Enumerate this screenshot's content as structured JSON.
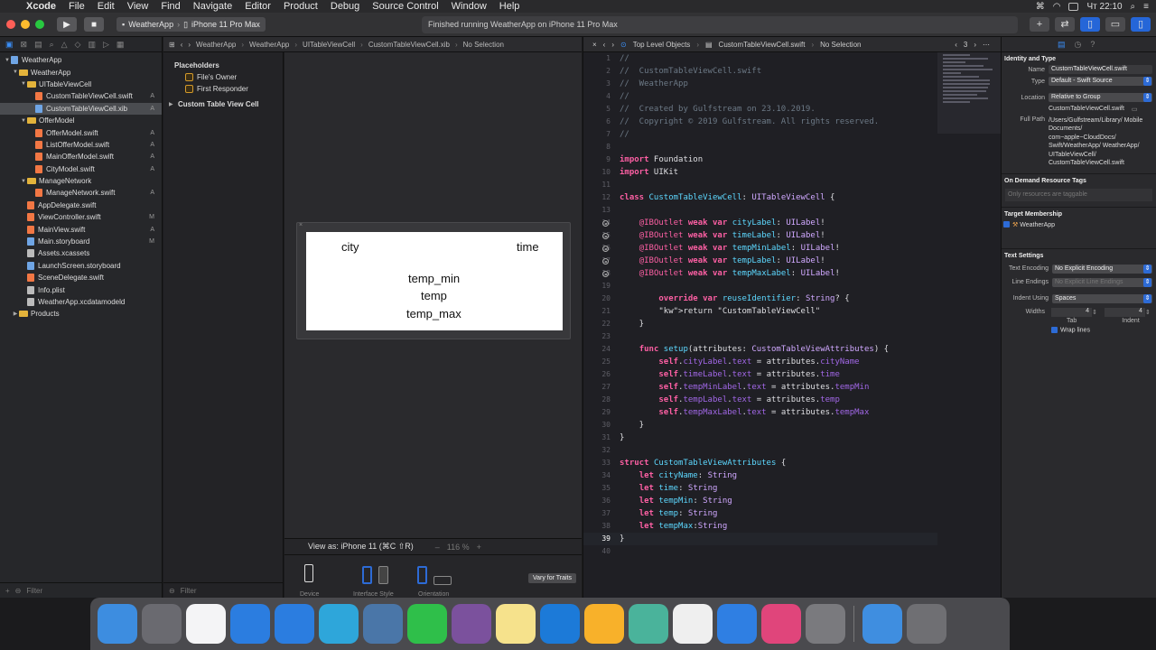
{
  "menubar": {
    "app": "Xcode",
    "items": [
      "File",
      "Edit",
      "View",
      "Find",
      "Navigate",
      "Editor",
      "Product",
      "Debug",
      "Source Control",
      "Window",
      "Help"
    ],
    "clock": "Чт 22:10"
  },
  "toolbar": {
    "scheme": "WeatherApp",
    "device": "iPhone 11 Pro Max",
    "activity": "Finished running WeatherApp on iPhone 11 Pro Max"
  },
  "navigator": {
    "filter_placeholder": "Filter",
    "rows": [
      {
        "label": "WeatherApp",
        "level": 0,
        "kind": "project",
        "badge": ""
      },
      {
        "label": "WeatherApp",
        "level": 1,
        "kind": "folder",
        "badge": ""
      },
      {
        "label": "UITableViewCell",
        "level": 2,
        "kind": "folder",
        "badge": ""
      },
      {
        "label": "CustomTableViewCell.swift",
        "level": 3,
        "kind": "swift",
        "badge": "A"
      },
      {
        "label": "CustomTableViewCell.xib",
        "level": 3,
        "kind": "xib",
        "badge": "A"
      },
      {
        "label": "OfferModel",
        "level": 2,
        "kind": "folder",
        "badge": ""
      },
      {
        "label": "OfferModel.swift",
        "level": 3,
        "kind": "swift",
        "badge": "A"
      },
      {
        "label": "ListOfferModel.swift",
        "level": 3,
        "kind": "swift",
        "badge": "A"
      },
      {
        "label": "MainOfferModel.swift",
        "level": 3,
        "kind": "swift",
        "badge": "A"
      },
      {
        "label": "CityModel.swift",
        "level": 3,
        "kind": "swift",
        "badge": "A"
      },
      {
        "label": "ManageNetwork",
        "level": 2,
        "kind": "folder",
        "badge": ""
      },
      {
        "label": "ManageNetwork.swift",
        "level": 3,
        "kind": "swift",
        "badge": "A"
      },
      {
        "label": "AppDelegate.swift",
        "level": 2,
        "kind": "swift",
        "badge": ""
      },
      {
        "label": "ViewController.swift",
        "level": 2,
        "kind": "swift",
        "badge": "M"
      },
      {
        "label": "MainView.swift",
        "level": 2,
        "kind": "swift",
        "badge": "A"
      },
      {
        "label": "Main.storyboard",
        "level": 2,
        "kind": "xib",
        "badge": "M"
      },
      {
        "label": "Assets.xcassets",
        "level": 2,
        "kind": "plain",
        "badge": ""
      },
      {
        "label": "LaunchScreen.storyboard",
        "level": 2,
        "kind": "xib",
        "badge": ""
      },
      {
        "label": "SceneDelegate.swift",
        "level": 2,
        "kind": "swift",
        "badge": ""
      },
      {
        "label": "Info.plist",
        "level": 2,
        "kind": "plain",
        "badge": ""
      },
      {
        "label": "WeatherApp.xcdatamodeld",
        "level": 2,
        "kind": "plain",
        "badge": ""
      },
      {
        "label": "Products",
        "level": 1,
        "kind": "folder",
        "badge": ""
      }
    ]
  },
  "ib_jumpbar": {
    "crumbs": [
      "WeatherApp",
      "WeatherApp",
      "UITableViewCell",
      "CustomTableViewCell.xib",
      "No Selection"
    ]
  },
  "outline": {
    "placeholders": "Placeholders",
    "files_owner": "File's Owner",
    "first_responder": "First Responder",
    "cell": "Custom Table View Cell",
    "filter_placeholder": "Filter"
  },
  "cell_labels": {
    "city": "city",
    "time": "time",
    "temp_min": "temp_min",
    "temp": "temp",
    "temp_max": "temp_max"
  },
  "ib_bottom": {
    "view_as": "View as: iPhone 11 (⌘C ⇧R)",
    "zoom": "116 %",
    "device": "Device",
    "interface_style": "Interface Style",
    "orientation": "Orientation",
    "vary": "Vary for Traits"
  },
  "editor_jumpbar": {
    "crumbs": [
      "Top Level Objects",
      "CustomTableViewCell.swift",
      "No Selection"
    ],
    "counter": "3"
  },
  "code_lines": [
    {
      "n": "1",
      "t": "//",
      "c": "c"
    },
    {
      "n": "2",
      "t": "//  CustomTableViewCell.swift",
      "c": "c"
    },
    {
      "n": "3",
      "t": "//  WeatherApp",
      "c": "c"
    },
    {
      "n": "4",
      "t": "//",
      "c": "c"
    },
    {
      "n": "5",
      "t": "//  Created by Gulfstream on 23.10.2019.",
      "c": "c"
    },
    {
      "n": "6",
      "t": "//  Copyright © 2019 Gulfstream. All rights reserved.",
      "c": "c"
    },
    {
      "n": "7",
      "t": "//",
      "c": "c"
    },
    {
      "n": "8",
      "t": "",
      "c": ""
    },
    {
      "n": "9",
      "t": "import Foundation",
      "c": "imp"
    },
    {
      "n": "10",
      "t": "import UIKit",
      "c": "imp"
    },
    {
      "n": "11",
      "t": "",
      "c": ""
    },
    {
      "n": "12",
      "t": "class CustomTableViewCell: UITableViewCell {",
      "c": "cls"
    },
    {
      "n": "13",
      "t": "",
      "c": ""
    },
    {
      "n": "14",
      "t": "    @IBOutlet weak var cityLabel: UILabel!",
      "c": "out",
      "v": "cityLabel"
    },
    {
      "n": "15",
      "t": "    @IBOutlet weak var timeLabel: UILabel!",
      "c": "out",
      "v": "timeLabel"
    },
    {
      "n": "16",
      "t": "    @IBOutlet weak var tempMinLabel: UILabel!",
      "c": "out",
      "v": "tempMinLabel"
    },
    {
      "n": "17",
      "t": "    @IBOutlet weak var tempLabel: UILabel!",
      "c": "out",
      "v": "tempLabel"
    },
    {
      "n": "18",
      "t": "    @IBOutlet weak var tempMaxLabel: UILabel!",
      "c": "out",
      "v": "tempMaxLabel"
    },
    {
      "n": "19",
      "t": "",
      "c": ""
    },
    {
      "n": "20",
      "t": "        override var reuseIdentifier: String? {",
      "c": "ovr"
    },
    {
      "n": "21",
      "t": "        return \"CustomTableViewCell\"",
      "c": "ret"
    },
    {
      "n": "22",
      "t": "    }",
      "c": ""
    },
    {
      "n": "23",
      "t": "",
      "c": ""
    },
    {
      "n": "24",
      "t": "    func setup(attributes: CustomTableViewAttributes) {",
      "c": "fn"
    },
    {
      "n": "25",
      "t": "        self.cityLabel.text = attributes.cityName",
      "c": "asg",
      "a": "cityLabel",
      "b": "cityName"
    },
    {
      "n": "26",
      "t": "        self.timeLabel.text = attributes.time",
      "c": "asg",
      "a": "timeLabel",
      "b": "time"
    },
    {
      "n": "27",
      "t": "        self.tempMinLabel.text = attributes.tempMin",
      "c": "asg",
      "a": "tempMinLabel",
      "b": "tempMin"
    },
    {
      "n": "28",
      "t": "        self.tempLabel.text = attributes.temp",
      "c": "asg",
      "a": "tempLabel",
      "b": "temp"
    },
    {
      "n": "29",
      "t": "        self.tempMaxLabel.text = attributes.tempMax",
      "c": "asg",
      "a": "tempMaxLabel",
      "b": "tempMax"
    },
    {
      "n": "30",
      "t": "    }",
      "c": ""
    },
    {
      "n": "31",
      "t": "}",
      "c": ""
    },
    {
      "n": "32",
      "t": "",
      "c": ""
    },
    {
      "n": "33",
      "t": "struct CustomTableViewAttributes {",
      "c": "st"
    },
    {
      "n": "34",
      "t": "    let cityName: String",
      "c": "let",
      "v": "cityName"
    },
    {
      "n": "35",
      "t": "    let time: String",
      "c": "let",
      "v": "time"
    },
    {
      "n": "36",
      "t": "    let tempMin: String",
      "c": "let",
      "v": "tempMin"
    },
    {
      "n": "37",
      "t": "    let temp: String",
      "c": "let",
      "v": "temp"
    },
    {
      "n": "38",
      "t": "    let tempMax:String",
      "c": "let2",
      "v": "tempMax"
    },
    {
      "n": "39",
      "t": "}",
      "c": "cur"
    },
    {
      "n": "40",
      "t": "",
      "c": ""
    }
  ],
  "inspector": {
    "identity_title": "Identity and Type",
    "name_label": "Name",
    "name_value": "CustomTableViewCell.swift",
    "type_label": "Type",
    "type_value": "Default - Swift Source",
    "location_label": "Location",
    "location_value": "Relative to Group",
    "location_file": "CustomTableViewCell.swift",
    "fullpath_label": "Full Path",
    "fullpath_value": "/Users/Gulfstream/Library/ Mobile Documents/ com~apple~CloudDocs/ Swift/WeatherApp/ WeatherApp/ UITableViewCell/ CustomTableViewCell.swift",
    "odr_title": "On Demand Resource Tags",
    "odr_placeholder": "Only resources are taggable",
    "target_title": "Target Membership",
    "target_value": "WeatherApp",
    "text_title": "Text Settings",
    "enc_label": "Text Encoding",
    "enc_value": "No Explicit Encoding",
    "le_label": "Line Endings",
    "le_value": "No Explicit Line Endings",
    "indent_label": "Indent Using",
    "indent_value": "Spaces",
    "widths_label": "Widths",
    "tab_value": "4",
    "indent_num": "4",
    "tab_label": "Tab",
    "indent_label2": "Indent",
    "wrap_label": "Wrap lines"
  },
  "dock": [
    {
      "name": "finder",
      "color": "#3d8de0"
    },
    {
      "name": "launchpad",
      "color": "#6a6a70"
    },
    {
      "name": "music",
      "color": "#f4f4f6"
    },
    {
      "name": "safari",
      "color": "#2b7de0"
    },
    {
      "name": "spark",
      "color": "#2b7de0"
    },
    {
      "name": "telegram",
      "color": "#2ea6da"
    },
    {
      "name": "vk",
      "color": "#4a76a8"
    },
    {
      "name": "whatsapp",
      "color": "#2fbf4a"
    },
    {
      "name": "viber",
      "color": "#7b519d"
    },
    {
      "name": "notes",
      "color": "#f6e28c"
    },
    {
      "name": "xcode",
      "color": "#1c7ad8"
    },
    {
      "name": "sketch",
      "color": "#f8b12a"
    },
    {
      "name": "instruments",
      "color": "#4ab39b"
    },
    {
      "name": "textedit",
      "color": "#efefef"
    },
    {
      "name": "keynote",
      "color": "#2f7fe3"
    },
    {
      "name": "cleanmymac",
      "color": "#e0457b"
    },
    {
      "name": "preferences",
      "color": "#7a7a7e"
    },
    {
      "name": "downloads-folder",
      "color": "#3f8ee0"
    },
    {
      "name": "trash",
      "color": "#6f6f73"
    }
  ]
}
